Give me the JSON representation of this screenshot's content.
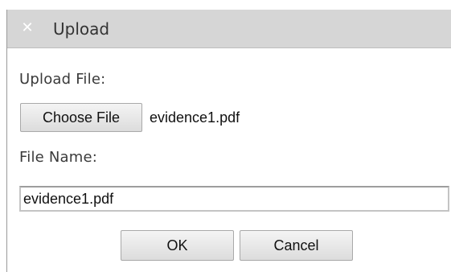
{
  "dialog": {
    "title": "Upload",
    "close_icon": "close-icon",
    "upload_label": "Upload File:",
    "choose_button_label": "Choose File",
    "chosen_file": "evidence1.pdf",
    "file_name_label": "File Name:",
    "file_name_value": "evidence1.pdf",
    "ok_label": "OK",
    "cancel_label": "Cancel"
  }
}
